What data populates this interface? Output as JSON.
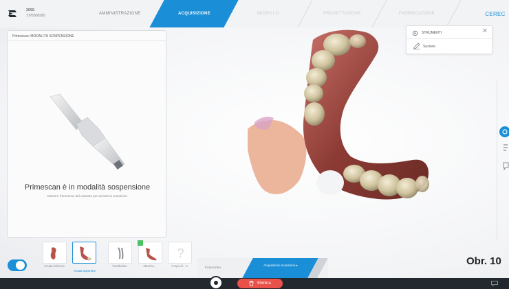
{
  "header": {
    "case_id": "2055",
    "case_date": "17/03/2020",
    "tabs": [
      {
        "label": "AMMINISTRAZIONE",
        "state": "normal"
      },
      {
        "label": "ACQUISIZIONE",
        "state": "active"
      },
      {
        "label": "MODELLO",
        "state": "disabled"
      },
      {
        "label": "PROGETTAZIONE",
        "state": "disabled"
      },
      {
        "label": "FABBRICAZIONE",
        "state": "disabled"
      },
      {
        "label": "CEREC",
        "state": "brand"
      }
    ]
  },
  "left_panel": {
    "title": "Primescan: MODALITÀ SOSPENSIONE",
    "heading": "Primescan è in modalità sospensione",
    "subtext": "Estrarre Primescan dal cassetto per avviare la scansione"
  },
  "tools_popup": {
    "title": "STRUMENTI",
    "item": "Sezione",
    "close": "✕"
  },
  "catalog": {
    "items": [
      {
        "label": "Arcata inferiore",
        "selected": false
      },
      {
        "label": "Arcata superiore",
        "selected": true
      },
      {
        "label": "Vestibolare",
        "selected": false
      },
      {
        "label": "Masche...",
        "selected": false
      },
      {
        "label": "Corpo di... ▾",
        "selected": false
      }
    ]
  },
  "bottom_tabs": {
    "photo": "Foto/Video",
    "scan": "Acquisizioni scansione ▸"
  },
  "actions": {
    "delete": "Elimina"
  },
  "figure_label": "Obr. 10",
  "colors": {
    "accent": "#1a8fd8",
    "delete": "#e8524a",
    "bottombar": "#22282e"
  }
}
